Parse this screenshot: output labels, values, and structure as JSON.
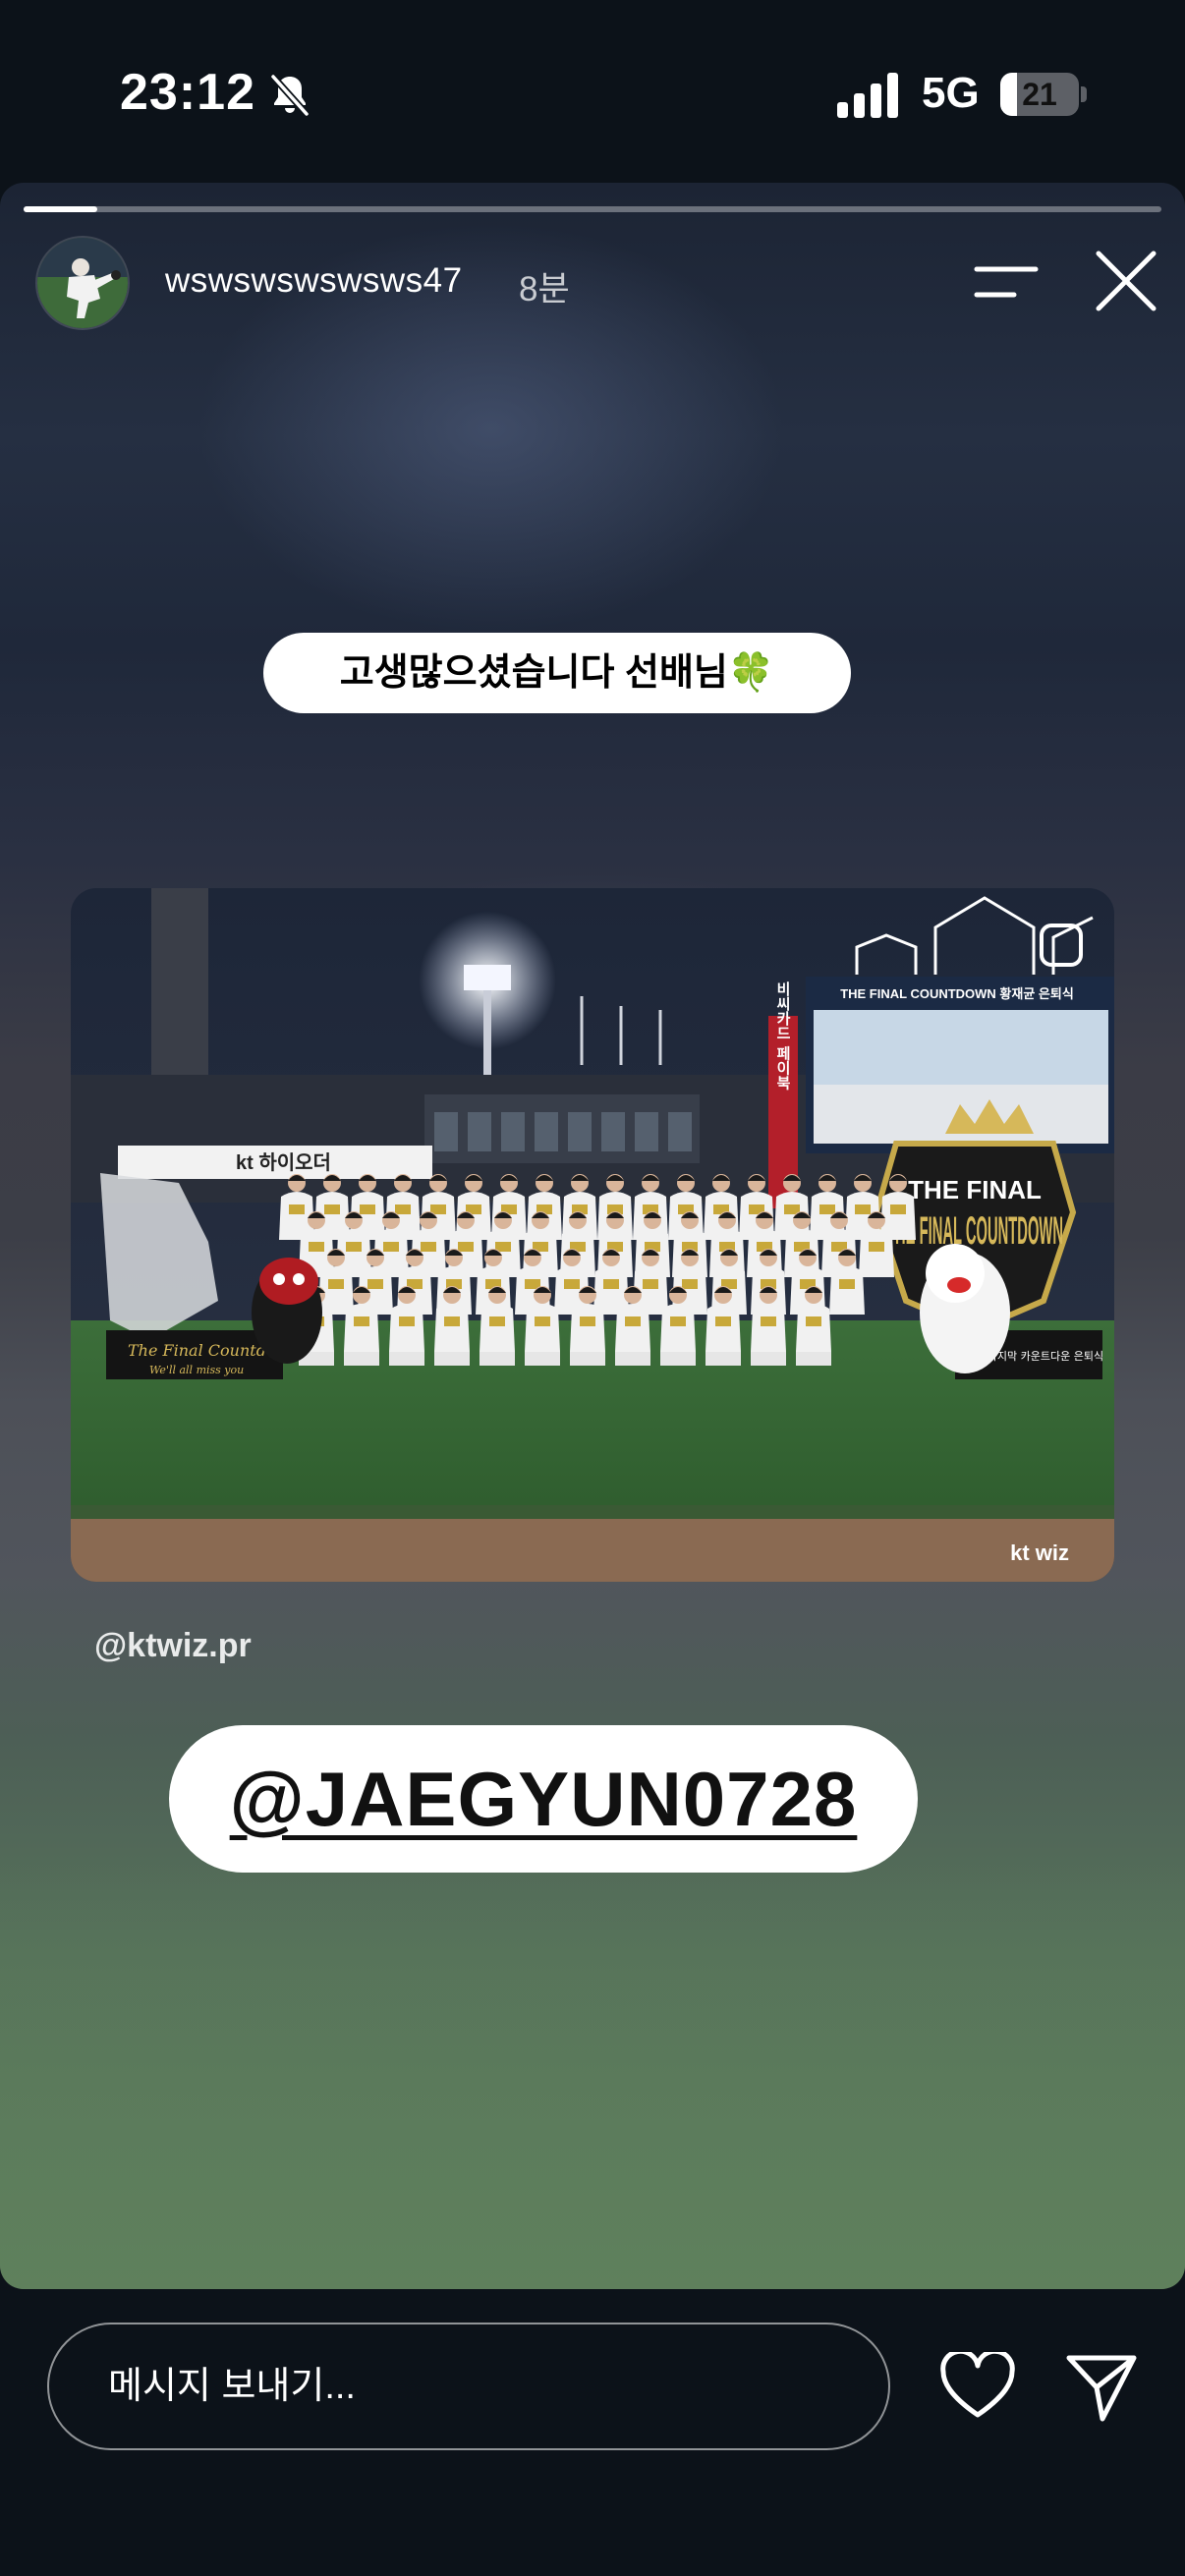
{
  "status_bar": {
    "time": "23:12",
    "network": "5G",
    "battery_level": "21",
    "battery_fraction": 0.21,
    "icons": [
      "bell-slash-icon",
      "cellular-signal-icon",
      "battery-icon"
    ]
  },
  "story": {
    "progress_fraction": 0.065,
    "username": "wswswswswsws47",
    "time_ago": "8분",
    "caption": "고생많으셨습니다 선배님",
    "caption_emoji": "🍀",
    "photo": {
      "watermark": "kt wiz",
      "banner_text": "THE FINAL COUNTDOWN",
      "banner_left": "The Final Countdown",
      "banner_left_sub": "We'll all miss you",
      "scoreboard_top": "THE FINAL COUNTDOWN 황재균 은퇴식",
      "bottom_right_sign": "황재균 마지막 카운트다운 은퇴식",
      "stadium_sign": "kt 하이오더",
      "vertical_sign": "비씨카드 페이북"
    },
    "source_tag": "@ktwiz.pr",
    "mention": "@JAEGYUN0728",
    "icons": [
      "menu-lines-icon",
      "close-icon"
    ]
  },
  "bottom_bar": {
    "message_placeholder": "메시지 보내기...",
    "icons": [
      "heart-icon",
      "send-icon"
    ]
  },
  "colors": {
    "background": "#0c1219",
    "pill": "#ffffff",
    "clover": "#2e9e3c"
  }
}
